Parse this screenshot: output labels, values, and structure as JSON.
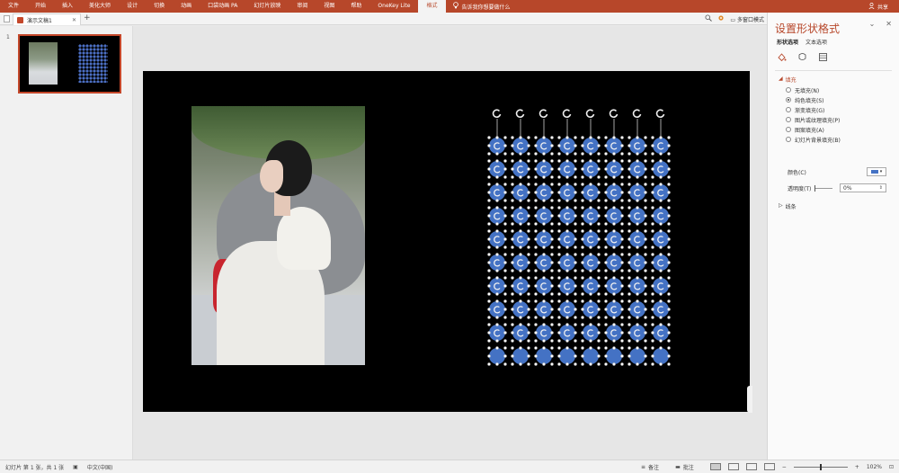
{
  "ribbon": {
    "tabs": [
      "文件",
      "开始",
      "插入",
      "美化大师",
      "设计",
      "切换",
      "动画",
      "口袋动画 PA",
      "幻灯片放映",
      "审阅",
      "视图",
      "帮助",
      "OneKey Lite",
      "格式"
    ],
    "active_tab": "格式",
    "tell_me": "告诉我你想要做什么",
    "share": "共享"
  },
  "docbar": {
    "doc_tab": "演示文稿1",
    "multi_window": "多窗口模式"
  },
  "thumbs": {
    "slide_number": "1"
  },
  "format_pane": {
    "title": "设置形状格式",
    "subtabs": [
      "形状选项",
      "文本选项"
    ],
    "icons": [
      "fill-line-icon",
      "effects-icon",
      "size-properties-icon"
    ],
    "fill_section": "填充",
    "fill_options": [
      {
        "label": "无填充(N)",
        "selected": false
      },
      {
        "label": "纯色填充(S)",
        "selected": true
      },
      {
        "label": "渐变填充(G)",
        "selected": false
      },
      {
        "label": "图片或纹理填充(P)",
        "selected": false
      },
      {
        "label": "图案填充(A)",
        "selected": false
      },
      {
        "label": "幻灯片背景填充(B)",
        "selected": false
      }
    ],
    "color_label": "颜色(C)",
    "transparency_label": "透明度(T)",
    "transparency_value": "0%",
    "line_section": "线条",
    "fill_color": "#4472c4"
  },
  "status": {
    "slide_info": "幻灯片 第 1 张，共 1 张",
    "language": "中文(中国)",
    "notes": "备注",
    "comments": "批注",
    "zoom": "102%",
    "zoom_level_percent": 102
  },
  "grid": {
    "columns": 8,
    "rows": 10,
    "circle_color": "#4472c4",
    "dot_color": "#ffffff"
  }
}
